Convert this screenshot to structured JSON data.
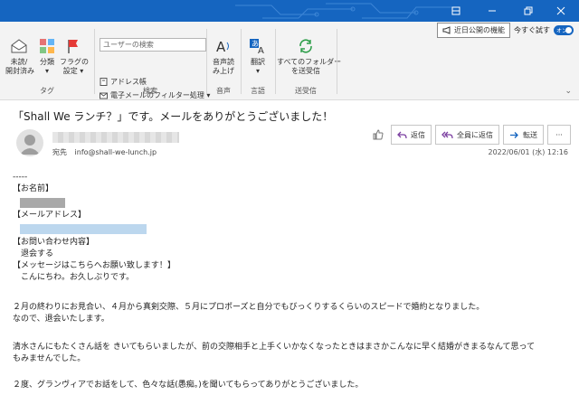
{
  "colors": {
    "accent": "#1565c0",
    "reply_purple": "#7b3fa0",
    "forward_blue": "#1565c0"
  },
  "titlebar": {
    "icons": [
      "restore-icon",
      "minimize-icon",
      "maximize-icon",
      "close-icon"
    ]
  },
  "ribbon": {
    "tags": {
      "label": "タグ",
      "unread": "未読/\n開封済み",
      "categorize": "分類\n▾",
      "flag": "フラグの\n設定 ▾"
    },
    "search": {
      "label": "検索",
      "placeholder": "ユーザーの検索",
      "address_book": "アドレス帳",
      "filter": "電子メールのフィルター処理 ▾"
    },
    "speech": {
      "label": "音声",
      "read_aloud": "音声読\nみ上げ"
    },
    "language": {
      "label": "言語",
      "translate": "翻訳\n▾"
    },
    "sendrecv": {
      "label": "送受信",
      "send_all": "すべてのフォルダー\nを送受信"
    },
    "preview_feature": "近日公開の機能",
    "try_now": "今すぐ試す",
    "toggle_text": "オン"
  },
  "message": {
    "subject": "「Shall We ランチ？」です。メールをありがとうございました！",
    "to_label": "宛先",
    "to_address": "info@shall-we-lunch.jp",
    "date": "2022/06/01 (水) 12:16",
    "actions": {
      "reply": "返信",
      "reply_all": "全員に返信",
      "forward": "転送",
      "more": "···"
    }
  },
  "body_lines": [
    "-----",
    "【お名前】",
    "",
    "【メールアドレス】",
    "",
    "【お問い合わせ内容】",
    "　退会する",
    "【メッセージはこちらへお願い致します！】",
    "　こんにちわ。お久しぶりです。",
    "",
    "２月の終わりにお見合い、４月から真剣交際、５月にプロポーズと自分でもびっくりするくらいのスピードで婚約となりました。",
    "なので、退会いたします。",
    "",
    "清水さんにもたくさん話を きいてもらいましたが、前の交際相手と上手くいかなくなったときはまさかこんなに早く結婚がきまるなんて思って",
    "もみませんでした。",
    "",
    "２度、グランヴィアでお話をして、色々な話(愚痴。)を聞いてもらってありがとうございました。"
  ]
}
